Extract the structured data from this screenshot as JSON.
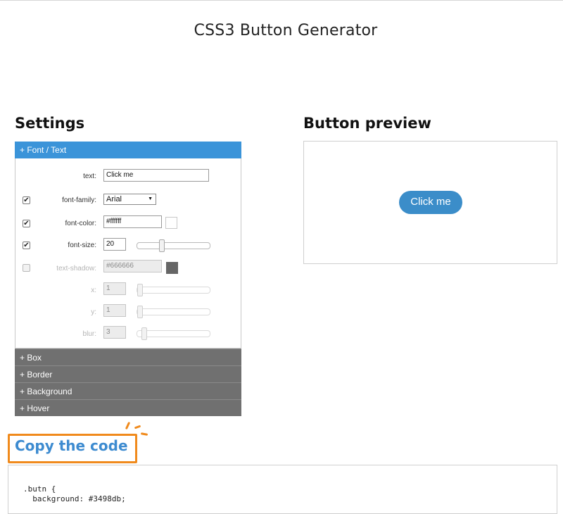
{
  "page": {
    "title": "CSS3 Button Generator"
  },
  "settings": {
    "heading": "Settings",
    "font_text": {
      "header": "+ Font / Text",
      "text": {
        "label": "text:",
        "value": "Click me"
      },
      "font_family": {
        "label": "font-family:",
        "checked": true,
        "value": "Arial",
        "arrow": "▼"
      },
      "font_color": {
        "label": "font-color:",
        "checked": true,
        "value": "#ffffff",
        "swatch": "#ffffff"
      },
      "font_size": {
        "label": "font-size:",
        "checked": true,
        "value": "20",
        "slider_fraction": 0.33
      },
      "text_shadow": {
        "label": "text-shadow:",
        "checked": false,
        "value": "#666666",
        "swatch": "#666666"
      },
      "shadow_x": {
        "label": "x:",
        "value": "1",
        "slider_fraction": 0.0
      },
      "shadow_y": {
        "label": "y:",
        "value": "1",
        "slider_fraction": 0.0
      },
      "shadow_blur": {
        "label": "blur:",
        "value": "3",
        "slider_fraction": 0.06
      }
    },
    "sections": {
      "box": "+ Box",
      "border": "+ Border",
      "background": "+ Background",
      "hover": "+ Hover"
    }
  },
  "preview": {
    "heading": "Button preview",
    "button_label": "Click me",
    "button_color": "#3b8dc9"
  },
  "code": {
    "heading": "Copy the code",
    "lines": [
      ".butn {",
      "  background: #3498db;"
    ]
  },
  "colors": {
    "accent": "#3b94d9",
    "collapsed_header": "#707070",
    "highlight": "#f08a1c"
  }
}
